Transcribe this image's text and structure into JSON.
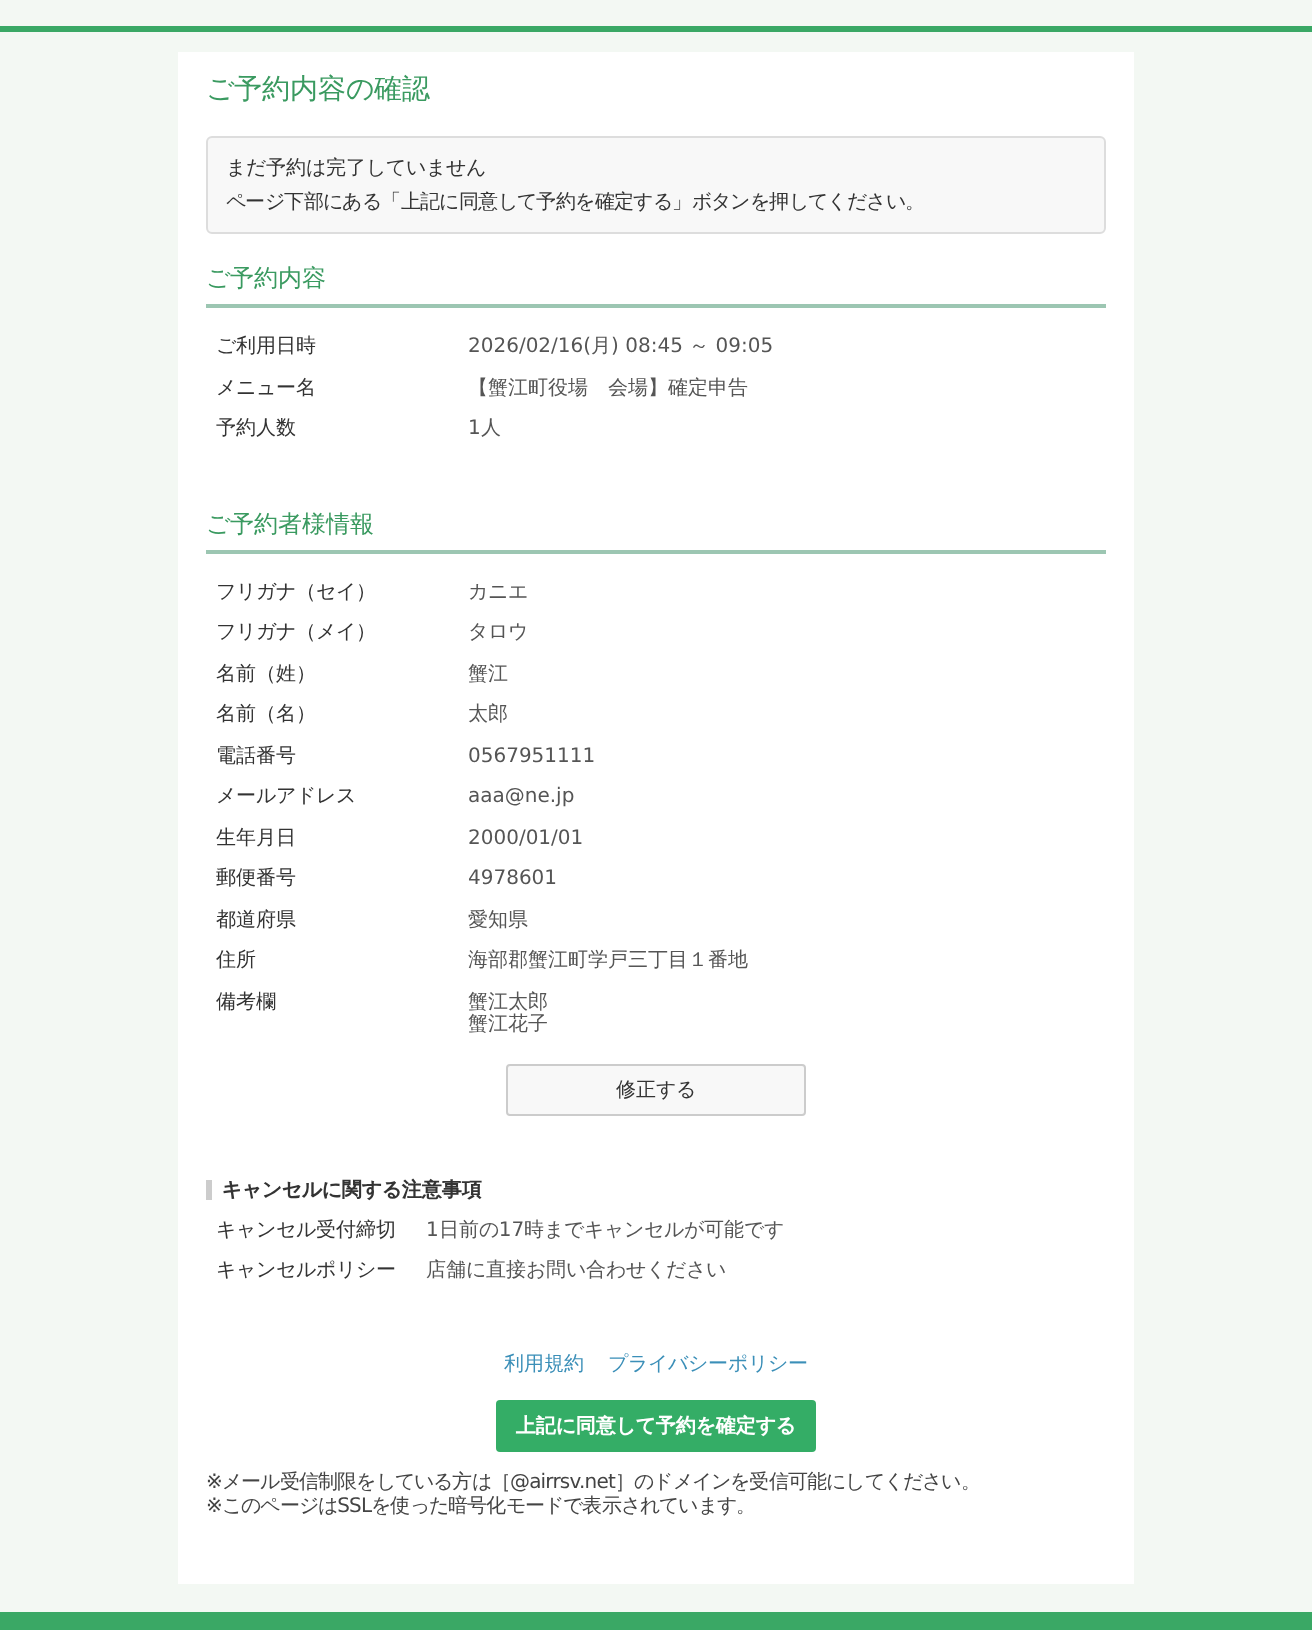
{
  "page_title": "ご予約内容の確認",
  "notice": {
    "title": "まだ予約は完了していません",
    "text": "ページ下部にある「上記に同意して予約を確定する」ボタンを押してください。"
  },
  "reservation": {
    "heading": "ご予約内容",
    "rows": [
      {
        "label": "ご利用日時",
        "lines": [
          "2026/02/16(月) 08:45 ～ 09:05"
        ]
      },
      {
        "label": "メニュー名",
        "lines": [
          "【蟹江町役場　会場】確定申告"
        ]
      },
      {
        "label": "予約人数",
        "lines": [
          "1人"
        ]
      }
    ]
  },
  "customer": {
    "heading": "ご予約者様情報",
    "rows": [
      {
        "label": "フリガナ（セイ）",
        "lines": [
          "カニエ"
        ]
      },
      {
        "label": "フリガナ（メイ）",
        "lines": [
          "タロウ"
        ]
      },
      {
        "label": "名前（姓）",
        "lines": [
          "蟹江"
        ]
      },
      {
        "label": "名前（名）",
        "lines": [
          "太郎"
        ]
      },
      {
        "label": "電話番号",
        "lines": [
          "0567951111"
        ]
      },
      {
        "label": "メールアドレス",
        "lines": [
          "aaa@ne.jp"
        ]
      },
      {
        "label": "生年月日",
        "lines": [
          "2000/01/01"
        ]
      },
      {
        "label": "郵便番号",
        "lines": [
          "4978601"
        ]
      },
      {
        "label": "都道府県",
        "lines": [
          "愛知県"
        ]
      },
      {
        "label": "住所",
        "lines": [
          "海部郡蟹江町学戸三丁目１番地"
        ]
      },
      {
        "label": "備考欄",
        "lines": [
          "蟹江太郎",
          "蟹江花子"
        ]
      }
    ]
  },
  "edit_button": "修正する",
  "cancel": {
    "heading": "キャンセルに関する注意事項",
    "rows": [
      {
        "label": "キャンセル受付締切",
        "lines": [
          "1日前の17時までキャンセルが可能です"
        ]
      },
      {
        "label": "キャンセルポリシー",
        "lines": [
          "店舗に直接お問い合わせください"
        ]
      }
    ]
  },
  "links": [
    "利用規約",
    "プライバシーポリシー"
  ],
  "confirm_button": "上記に同意して予約を確定する",
  "notes": [
    "※メール受信制限をしている方は［@airrsv.net］のドメインを受信可能にしてください。",
    "※このページはSSLを使った暗号化モードで表示されています。"
  ]
}
